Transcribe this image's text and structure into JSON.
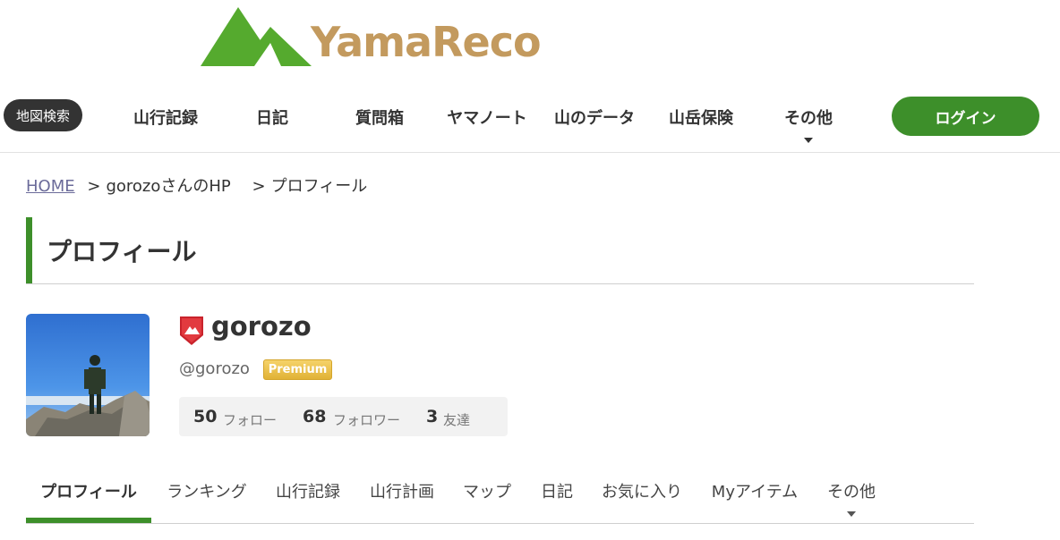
{
  "brand": {
    "name": "YamaReco",
    "accent_color": "#3d8f2a",
    "text_color": "#c39a5e"
  },
  "nav": {
    "map_search": "地図検索",
    "items": [
      "山行記録",
      "日記",
      "質問箱",
      "ヤマノート",
      "山のデータ",
      "山岳保険",
      "その他"
    ],
    "login": "ログイン"
  },
  "breadcrumb": {
    "home": "HOME",
    "user_hp": "gorozoさんのHP",
    "current": "プロフィール",
    "separator": ">"
  },
  "page_title": "プロフィール",
  "profile": {
    "badge_icon": "shield-mountain-icon",
    "username": "gorozo",
    "handle": "@gorozo",
    "premium_label": "Premium",
    "stats": {
      "follow_count": "50",
      "follow_label": "フォロー",
      "follower_count": "68",
      "follower_label": "フォロワー",
      "friend_count": "3",
      "friend_label": "友達"
    }
  },
  "tabs": {
    "items": [
      "プロフィール",
      "ランキング",
      "山行記録",
      "山行計画",
      "マップ",
      "日記",
      "お気に入り",
      "Myアイテム",
      "その他"
    ],
    "active_index": 0
  }
}
